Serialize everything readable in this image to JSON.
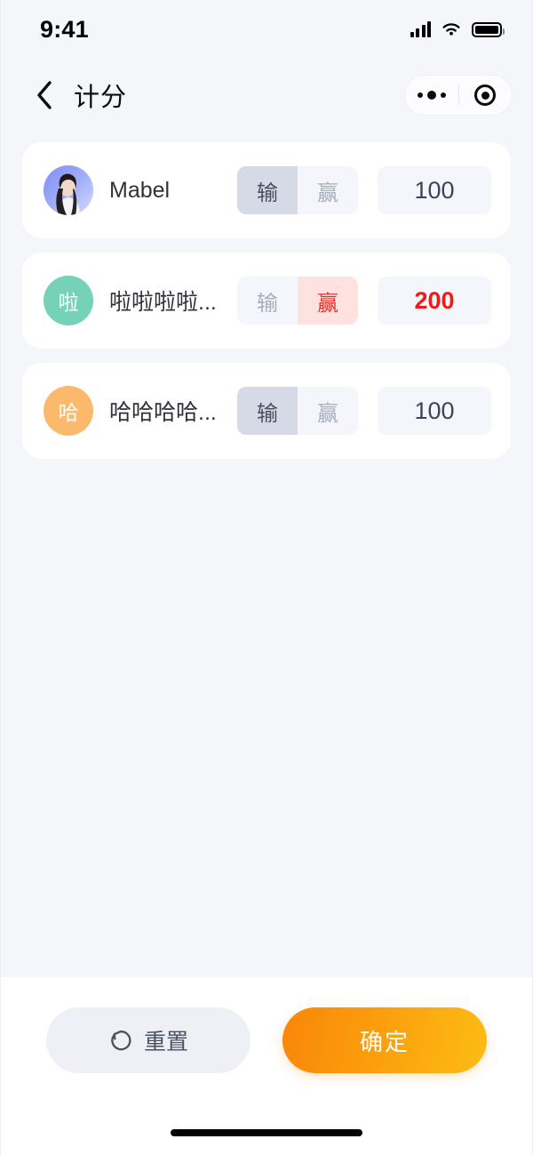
{
  "status_bar": {
    "time": "9:41",
    "signal_icon": "cellular-signal-icon",
    "wifi_icon": "wifi-icon",
    "battery_icon": "battery-full-icon"
  },
  "nav": {
    "back_icon": "chevron-left-icon",
    "title": "计分",
    "capsule": {
      "more_icon": "more-dots-icon",
      "target_icon": "target-circle-icon"
    }
  },
  "segment_labels": {
    "lose": "输",
    "win": "赢"
  },
  "players": [
    {
      "name": "Mabel",
      "avatar_type": "photo",
      "avatar_text": "",
      "avatar_color": "#8b9bf6",
      "result": "lose",
      "score": "100"
    },
    {
      "name": "啦啦啦啦...",
      "avatar_type": "initial",
      "avatar_text": "啦",
      "avatar_color": "#76d2b7",
      "result": "win",
      "score": "200"
    },
    {
      "name": "哈哈哈哈...",
      "avatar_type": "initial",
      "avatar_text": "哈",
      "avatar_color": "#fab96b",
      "result": "lose",
      "score": "100"
    }
  ],
  "footer": {
    "reset_label": "重置",
    "reset_icon": "refresh-ccw-icon",
    "confirm_label": "确定"
  },
  "colors": {
    "page_background": "#f5f6fa",
    "card_background": "#ffffff",
    "segment_selected_lose": "#d6dae6",
    "segment_selected_win": "#fde2df",
    "segment_idle": "#f4f6fb",
    "win_text": "#e8312b",
    "score_text": "#3d4459",
    "confirm_gradient_start": "#fa8609",
    "confirm_gradient_end": "#fcbc14"
  }
}
